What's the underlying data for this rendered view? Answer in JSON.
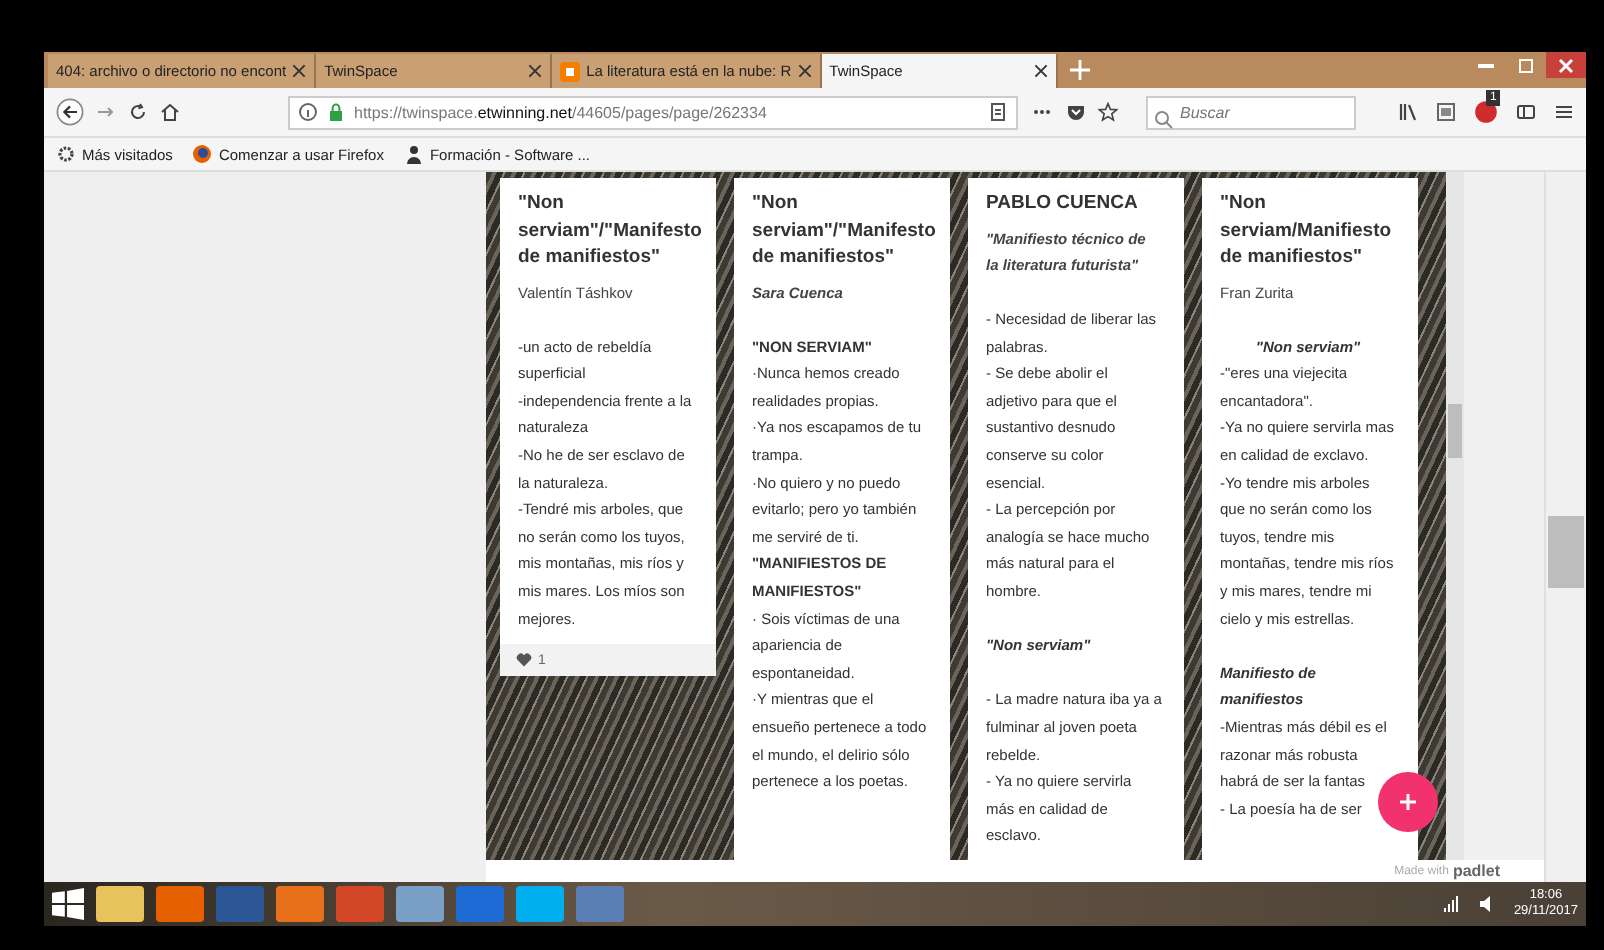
{
  "browser": {
    "tabs": [
      {
        "label": "404: archivo o directorio no encont",
        "selected": false,
        "favicon": false
      },
      {
        "label": "TwinSpace",
        "selected": false,
        "favicon": false
      },
      {
        "label": "La literatura está en la nube: R",
        "selected": false,
        "favicon": true
      },
      {
        "label": "TwinSpace",
        "selected": true,
        "favicon": false
      }
    ],
    "url": {
      "host": "https://twinspace.",
      "domain": "etwinning.net",
      "path": "/44605/pages/page/262334"
    },
    "search": {
      "placeholder": "Buscar"
    },
    "notification_count": "1",
    "bookmarks": [
      "Más visitados",
      "Comenzar a usar Firefox",
      "Formación - Software ..."
    ]
  },
  "cards": [
    {
      "title": "\"Non serviam\"/\"Manifesto de manifiestos\"",
      "author": "Valentín Táshkov",
      "author_emphasis": false,
      "likes": "1",
      "paragraphs": [
        {
          "kind": "gap"
        },
        {
          "kind": "text",
          "text": "-un acto de rebeldía superficial"
        },
        {
          "kind": "text",
          "text": "-independencia frente a la naturaleza"
        },
        {
          "kind": "text",
          "text": "-No he de ser esclavo de la naturaleza."
        },
        {
          "kind": "text",
          "text": "-Tendré mis arboles, que no serán como los tuyos, mis montañas, mis ríos y mis mares. Los míos son mejores."
        }
      ]
    },
    {
      "title": "\"Non serviam\"/\"Manifesto de manifiestos\"",
      "author": "Sara Cuenca",
      "author_emphasis": true,
      "paragraphs": [
        {
          "kind": "gap"
        },
        {
          "kind": "bold",
          "text": "\"NON SERVIAM\""
        },
        {
          "kind": "text",
          "text": "·Nunca hemos creado realidades propias."
        },
        {
          "kind": "text",
          "text": "·Ya nos escapamos de tu trampa."
        },
        {
          "kind": "text",
          "text": "·No quiero y no puedo evitarlo; pero yo también me serviré de ti."
        },
        {
          "kind": "bold",
          "text": "\"MANIFIESTOS DE MANIFIESTOS\""
        },
        {
          "kind": "text",
          "text": "· Sois víctimas de una apariencia de espontaneidad."
        },
        {
          "kind": "text",
          "text": "·Y mientras que el ensueño pertenece a todo el mundo, el delirio sólo pertenece a los poetas."
        }
      ]
    },
    {
      "title": "PABLO CUENCA",
      "author": "\"Manifiesto técnico de la literatura futurista\"",
      "author_emphasis": true,
      "paragraphs": [
        {
          "kind": "gap"
        },
        {
          "kind": "text",
          "text": "- Necesidad de liberar las palabras."
        },
        {
          "kind": "text",
          "text": "- Se debe abolir el adjetivo para que el sustantivo desnudo conserve su color esencial."
        },
        {
          "kind": "text",
          "text": "- La percepción por analogía se hace mucho más natural para el hombre."
        },
        {
          "kind": "gap"
        },
        {
          "kind": "bold-italic",
          "text": "\"Non serviam\""
        },
        {
          "kind": "gap"
        },
        {
          "kind": "text",
          "text": "- La madre natura iba ya a fulminar al joven poeta rebelde."
        },
        {
          "kind": "text",
          "text": "- Ya no quiere servirla más en calidad de esclavo."
        }
      ]
    },
    {
      "title": "\"Non serviam/Manifiesto de  manifiestos\"",
      "author": "Fran Zurita",
      "author_emphasis": false,
      "paragraphs": [
        {
          "kind": "gap"
        },
        {
          "kind": "centered-bold-italic",
          "text": "\"Non serviam\""
        },
        {
          "kind": "text",
          "text": "-\"eres una viejecita encantadora\"."
        },
        {
          "kind": "text",
          "text": "-Ya no quiere servirla mas en calidad de exclavo."
        },
        {
          "kind": "text",
          "text": "-Yo tendre mis arboles que no serán como los tuyos, tendre mis montañas, tendre mis ríos y mis mares, tendre mi cielo y mis estrellas."
        },
        {
          "kind": "gap"
        },
        {
          "kind": "bold-italic",
          "text": "Manifiesto de manifiestos"
        },
        {
          "kind": "text",
          "text": "-Mientras más débil es el razonar más robusta habrá de ser la fantas"
        },
        {
          "kind": "text",
          "text": "- La poesía ha de ser"
        }
      ]
    }
  ],
  "footer": {
    "made_with": "Made with",
    "brand": "padlet"
  },
  "taskbar": {
    "time": "18:06",
    "date": "29/11/2017"
  }
}
